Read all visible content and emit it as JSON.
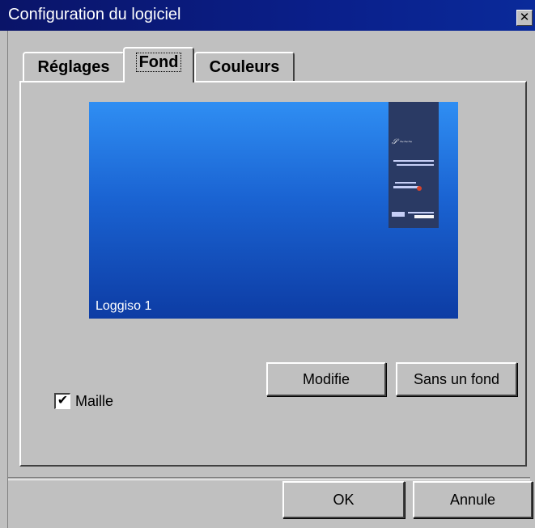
{
  "window": {
    "title": "Configuration du logiciel",
    "close_label": "x"
  },
  "tabs": [
    {
      "label": "Réglages",
      "active": false
    },
    {
      "label": "Fond",
      "active": true
    },
    {
      "label": "Couleurs",
      "active": false
    }
  ],
  "preview": {
    "caption": "Loggiso 1",
    "logos": [
      "logo 1",
      "logo 2",
      "logo 3",
      "logo 4"
    ]
  },
  "buttons": {
    "modify": "Modifie",
    "no_background": "Sans un fond",
    "ok": "OK",
    "cancel": "Annule"
  },
  "checkbox": {
    "label": "Maille",
    "checked": true
  },
  "colors": {
    "titlebar": "#0a1f8a",
    "dialog": "#c0c0c0",
    "preview_top": "#2f8ef3",
    "preview_bottom": "#0d3ca4"
  }
}
